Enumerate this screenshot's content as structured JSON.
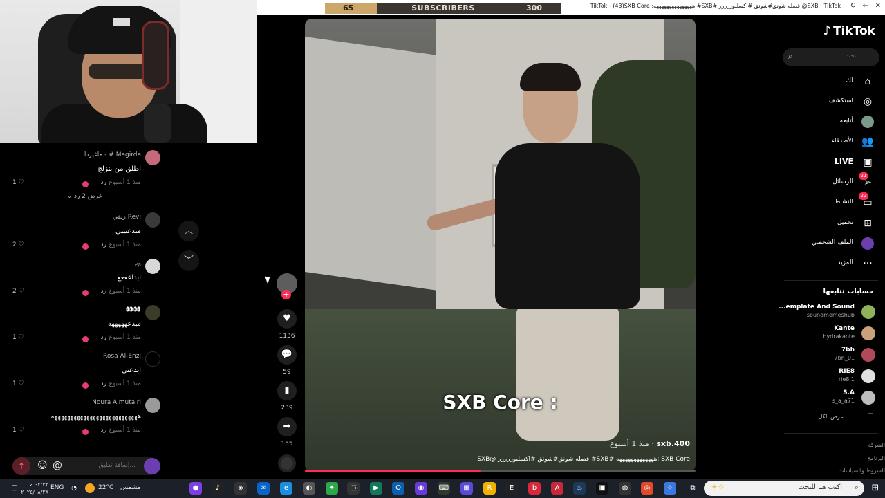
{
  "subscriber_goal": {
    "current": "65",
    "label": "SUBSCRIBERS",
    "goal": "300",
    "progress_fraction": 0.22
  },
  "browser": {
    "window_title": "TikTok - (43)SXB Core :هههههههههههههههه #SXB# قصله شونق#شونق #اكسلبوررررر @SXB | TikTok"
  },
  "comments": [
    {
      "user": "Magirda # - ماغيردا",
      "text": "اطلق من يتزلج",
      "time": "منذ 1 أسبوع",
      "reply": "رد",
      "likes": "1",
      "avatar_color": "#c46a7a"
    },
    {
      "user": "Revi ريفي",
      "text": "مبدعيييي",
      "time": "منذ 1 أسبوع",
      "reply": "رد",
      "likes": "2",
      "avatar_color": "#3a3a3a"
    },
    {
      "user": "ঞ",
      "text": "ابداعععع",
      "time": "منذ 1 أسبوع",
      "reply": "رد",
      "likes": "2",
      "avatar_color": "#d8d8d8"
    },
    {
      "user": "👀👀",
      "text": "مبدعهههههه",
      "time": "منذ 1 أسبوع",
      "reply": "رد",
      "likes": "1",
      "avatar_color": "#3b3b2a"
    },
    {
      "user": "Rosa Al-Enzi",
      "text": "ابدعتي",
      "time": "منذ 1 أسبوع",
      "reply": "رد",
      "likes": "1",
      "avatar_color": "#000000"
    },
    {
      "user": "Noura Almutairi",
      "text": "هههههههههههههههههههههههههههه",
      "time": "منذ 1 أسبوع",
      "reply": "رد",
      "likes": "1",
      "avatar_color": "#9a9a9a"
    }
  ],
  "show_replies": "عرض 2 رد",
  "comment_input": {
    "placeholder": "إضافة تعليق...",
    "send_icon": "send-icon",
    "emoji_icon": "emoji-icon",
    "mention_icon": "at-icon"
  },
  "video": {
    "caption": "SXB Core :",
    "author": "sxb.400",
    "time_ago": "منذ 1 أسبوع",
    "description": "SXB Core :هههههههههههههه #SXB# قصله شونق#شونق #اكسلبوررررر @SXB",
    "progress_fraction": 0.45
  },
  "actions": {
    "likes": "1136",
    "comments": "59",
    "saves": "239",
    "shares": "155"
  },
  "sidebar": {
    "logo": "TikTok",
    "search_placeholder": "بحث",
    "nav": [
      {
        "label": "لك",
        "icon": "home-icon"
      },
      {
        "label": "استكشف",
        "icon": "compass-icon"
      },
      {
        "label": "أتابعه",
        "icon": "following-avatar"
      },
      {
        "label": "الأصدقاء",
        "icon": "friends-icon"
      },
      {
        "label": "LIVE",
        "icon": "live-icon"
      },
      {
        "label": "الرسائل",
        "icon": "messages-icon",
        "badge": "21"
      },
      {
        "label": "النشاط",
        "icon": "activity-icon",
        "badge": "22"
      },
      {
        "label": "تحميل",
        "icon": "upload-icon"
      },
      {
        "label": "الملف الشخصي",
        "icon": "profile-avatar"
      },
      {
        "label": "المزيد",
        "icon": "more-icon"
      }
    ],
    "following_header": "حسابات تتابعها",
    "following": [
      {
        "name": "...emplate And Sound",
        "handle": "soundmemeshub",
        "color": "#8fb25a"
      },
      {
        "name": "Kante",
        "handle": "hydrakante",
        "color": "#c9a27a"
      },
      {
        "name": "7bh",
        "handle": "7bh_01",
        "color": "#b04a5a"
      },
      {
        "name": "RIE8",
        "handle": "rie8.1",
        "color": "#e0e0e0"
      },
      {
        "name": "S.A",
        "handle": "s_a_a71",
        "color": "#bdbdbd"
      }
    ],
    "see_all": "عرض الكل",
    "footer": [
      "الشركة",
      "البرنامج",
      "الشروط والسياسات"
    ]
  },
  "taskbar": {
    "search_placeholder": "اكتب هنا للبحث",
    "weather": "22°C",
    "weather_desc": "مشمس",
    "lang": "ENG",
    "time": "٠٢:٣٣ م",
    "date": "٢٠٢٤/٠٨/٢٨"
  }
}
